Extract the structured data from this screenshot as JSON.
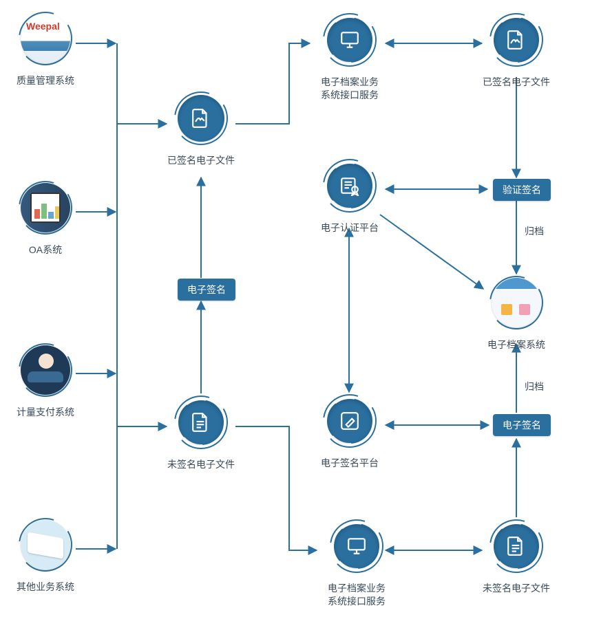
{
  "diagram": {
    "accent": "#2a6f9e",
    "arrow": "#2a6f9e"
  },
  "sources": {
    "quality": {
      "label": "质量管理系统"
    },
    "oa": {
      "label": "OA系统"
    },
    "measure": {
      "label": "计量支付系统"
    },
    "other": {
      "label": "其他业务系统"
    }
  },
  "center": {
    "signed": {
      "label": "已签名电子文件"
    },
    "unsigned": {
      "label": "未签名电子文件"
    },
    "esign_chip": "电子签名"
  },
  "right": {
    "interface_top": {
      "label": "电子档案业务\n系统接口服务"
    },
    "signed2": {
      "label": "已签名电子文件"
    },
    "cert_platform": {
      "label": "电子认证平台"
    },
    "verify_chip": "验证签名",
    "archive": {
      "label": "电子档案系统"
    },
    "esign_platform": {
      "label": "电子签名平台"
    },
    "esign_chip2": "电子签名",
    "interface_bottom": {
      "label": "电子档案业务\n系统接口服务"
    },
    "unsigned2": {
      "label": "未签名电子文件"
    },
    "archive_label": "归档"
  }
}
